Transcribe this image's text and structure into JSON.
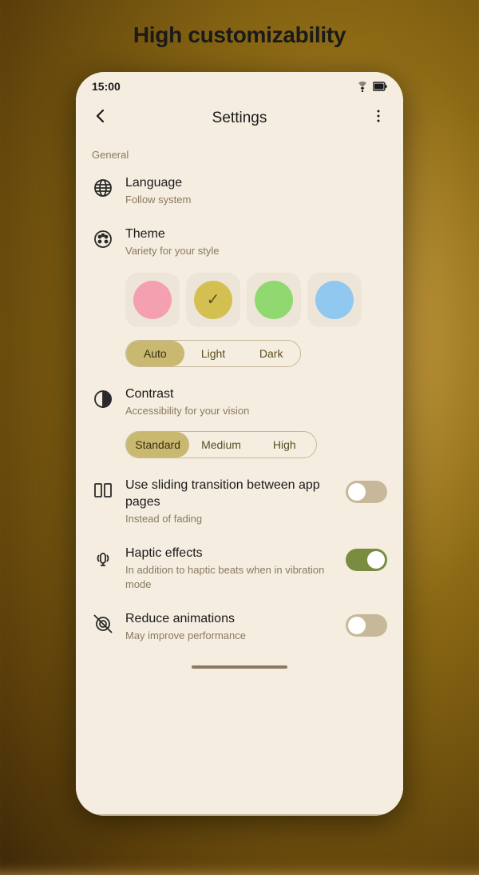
{
  "page": {
    "title": "High customizability",
    "background_colors": [
      "#d4a84b",
      "#8b6914",
      "#5a3e0a"
    ]
  },
  "phone": {
    "status_bar": {
      "time": "15:00",
      "wifi_icon": "▲",
      "battery_icon": "▮"
    },
    "top_bar": {
      "back_icon": "←",
      "title": "Settings",
      "more_icon": "⋮"
    },
    "sections": [
      {
        "label": "General",
        "items": [
          {
            "id": "language",
            "title": "Language",
            "subtitle": "Follow system",
            "icon": "globe"
          },
          {
            "id": "theme",
            "title": "Theme",
            "subtitle": "Variety for your style",
            "icon": "palette",
            "swatches": [
              {
                "color": "#f4a0b0",
                "selected": false
              },
              {
                "color": "#d4c050",
                "selected": true
              },
              {
                "color": "#90d870",
                "selected": false
              },
              {
                "color": "#90c8f0",
                "selected": false
              }
            ],
            "theme_options": [
              {
                "label": "Auto",
                "active": true
              },
              {
                "label": "Light",
                "active": false
              },
              {
                "label": "Dark",
                "active": false
              }
            ]
          },
          {
            "id": "contrast",
            "title": "Contrast",
            "subtitle": "Accessibility for your vision",
            "icon": "contrast",
            "contrast_options": [
              {
                "label": "Standard",
                "active": true
              },
              {
                "label": "Medium",
                "active": false
              },
              {
                "label": "High",
                "active": false
              }
            ]
          },
          {
            "id": "sliding",
            "title": "Use sliding transition between app pages",
            "subtitle": "Instead of fading",
            "icon": "pages",
            "toggle": "off"
          },
          {
            "id": "haptic",
            "title": "Haptic effects",
            "subtitle": "In addition to haptic beats when in vibration mode",
            "icon": "haptic",
            "toggle": "on"
          },
          {
            "id": "animations",
            "title": "Reduce animations",
            "subtitle": "May improve performance",
            "icon": "animations",
            "toggle": "off"
          }
        ]
      }
    ]
  }
}
